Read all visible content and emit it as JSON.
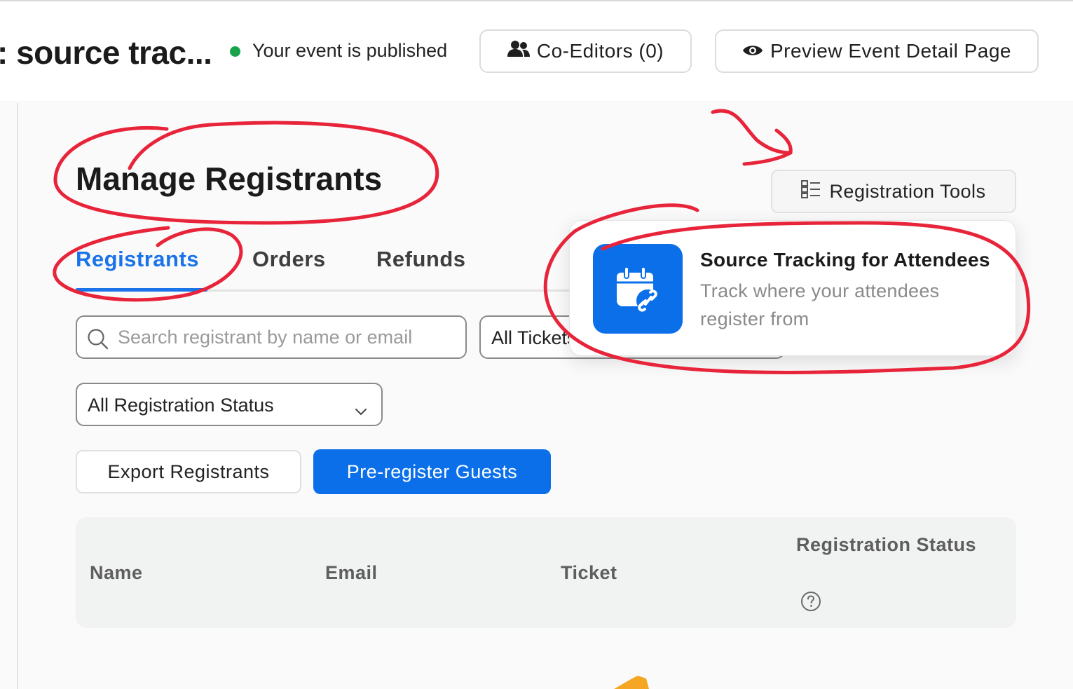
{
  "header": {
    "event_title": ": source trac...",
    "status_text": "Your event is published",
    "coeditors_label": "Co-Editors (0)",
    "preview_label": "Preview Event Detail Page"
  },
  "page": {
    "title": "Manage Registrants",
    "registration_tools_label": "Registration Tools"
  },
  "tabs": [
    {
      "label": "Registrants",
      "active": true
    },
    {
      "label": "Orders",
      "active": false
    },
    {
      "label": "Refunds",
      "active": false
    }
  ],
  "filters": {
    "search_placeholder": "Search registrant by name or email",
    "ticket_select_value": "All Tickets",
    "status_select_value": "All Registration Status"
  },
  "actions": {
    "export_label": "Export Registrants",
    "preregister_label": "Pre-register Guests"
  },
  "table": {
    "columns": [
      "Name",
      "Email",
      "Ticket",
      "Registration Status"
    ]
  },
  "popover": {
    "title": "Source Tracking for Attendees",
    "description": "Track where your attendees register from",
    "icon": "calendar-link-icon"
  },
  "colors": {
    "accent": "#0b6fe9",
    "status_green": "#18a34a",
    "annotation_red": "#e8243a"
  }
}
